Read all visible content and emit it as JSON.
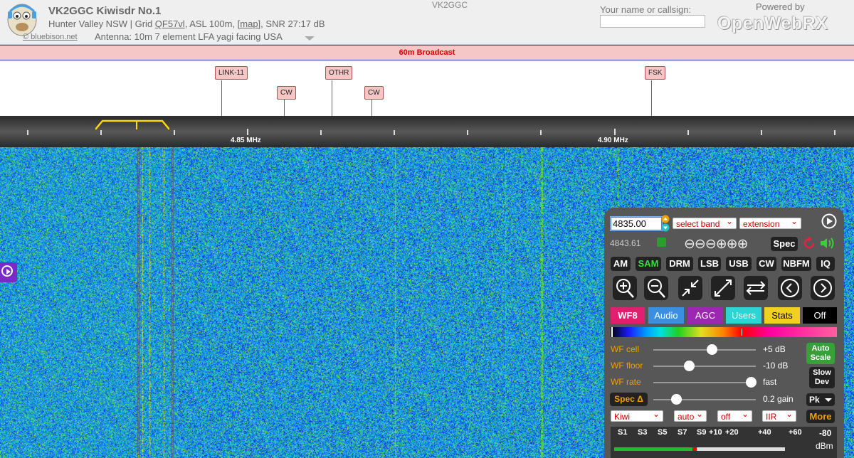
{
  "header": {
    "title": "VK2GGC Kiwisdr No.1",
    "location_prefix": "Hunter Valley NSW | Grid ",
    "grid": "QF57vl",
    "asl": ", ASL 100m, ",
    "map": "[map]",
    "snr": ", SNR 27:17 dB",
    "credit": "© bluebison.net",
    "antenna": "Antenna: 10m 7 element LFA yagi facing USA",
    "callsign_mid": "VK2GGC",
    "name_label": "Your name or callsign:",
    "name_value": "",
    "powered_by": "Powered by",
    "brand": "OpenWebRX"
  },
  "band_bar": {
    "label": "60m Broadcast",
    "color": "#d80000"
  },
  "dx_labels": [
    {
      "text": "LINK-11"
    },
    {
      "text": "CW"
    },
    {
      "text": "OTHR"
    },
    {
      "text": "CW"
    },
    {
      "text": "FSK"
    }
  ],
  "scale": {
    "labels": [
      "4.85 MHz",
      "4.90 MHz"
    ]
  },
  "panel": {
    "frequency": "4835.00",
    "band_select": "select band",
    "extension_select": "extension",
    "freq_secondary": "4843.61",
    "spec_button": "Spec",
    "modes": [
      "AM",
      "SAM",
      "DRM",
      "LSB",
      "USB",
      "CW",
      "NBFM",
      "IQ"
    ],
    "active_mode": "SAM",
    "tabs": [
      {
        "label": "WF8",
        "bg": "#e0206e",
        "fg": "#ffffff"
      },
      {
        "label": "Audio",
        "bg": "#3a8fe0",
        "fg": "#ffffff"
      },
      {
        "label": "AGC",
        "bg": "#9c27b0",
        "fg": "#ffffff"
      },
      {
        "label": "Users",
        "bg": "#2cd4d4",
        "fg": "#ffffff"
      },
      {
        "label": "Stats",
        "bg": "#f0d020",
        "fg": "#000000"
      },
      {
        "label": "Off",
        "bg": "#000000",
        "fg": "#ffffff"
      }
    ],
    "wf_cell": {
      "label": "WF cell",
      "value": "+5 dB",
      "level": 0.57
    },
    "wf_floor": {
      "label": "WF floor",
      "value": "-10 dB",
      "level": 0.35
    },
    "wf_rate": {
      "label": "WF rate",
      "value": "fast",
      "level": 0.95
    },
    "spec_delta": {
      "label": "Spec Δ",
      "value": "0.2 gain",
      "level": 0.22
    },
    "auto_scale": "Auto Scale",
    "slow_dev": "Slow Dev",
    "pk_select": "Pk",
    "kiwi_select": "Kiwi",
    "auto_select": "auto",
    "off_select": "off",
    "iir_select": "IIR",
    "more_button": "More",
    "smeter": {
      "labels": [
        "S1",
        "S3",
        "S5",
        "S7",
        "S9",
        "+10",
        "+20",
        "+40",
        "+60"
      ],
      "dbm_value": "-80",
      "dbm_unit": "dBm",
      "level": 0.46
    }
  }
}
